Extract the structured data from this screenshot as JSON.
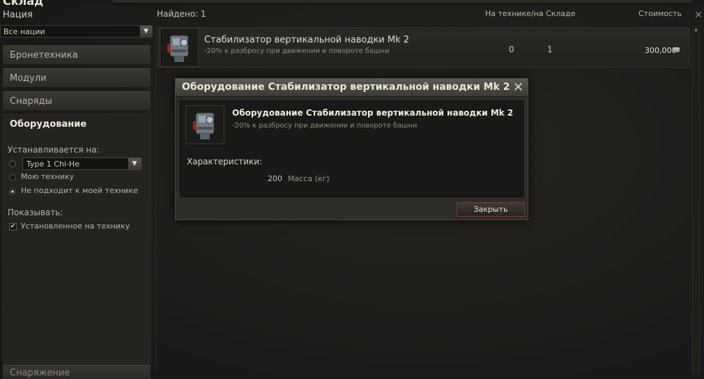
{
  "window": {
    "title": "Склад"
  },
  "sidebar": {
    "nation_label": "Нация",
    "nation_select": "Все нации",
    "categories": [
      {
        "label": "Бронетехника"
      },
      {
        "label": "Модули"
      },
      {
        "label": "Снаряды"
      },
      {
        "label": "Оборудование"
      }
    ],
    "installed_on_label": "Устанавливается на:",
    "vehicle_select": "Type 1 Chi-He",
    "radio_options": [
      {
        "label": "",
        "selected": false
      },
      {
        "label": "Мою технику",
        "selected": false
      },
      {
        "label": "Не подходит к моей технике",
        "selected": true
      }
    ],
    "show_label": "Показывать:",
    "checkbox_label": "Установленное на технику",
    "checkbox_checked": true,
    "bottom_category": "Снаряжение"
  },
  "header": {
    "found": "Найдено: 1",
    "col_vehicle_stock": "На технике/на Складе",
    "col_cost": "Стоимость"
  },
  "list": {
    "items": [
      {
        "title": "Стабилизатор вертикальной наводки Mk 2",
        "subtitle": "-20% к разбросу при движении и повороте башни",
        "on_vehicle": "0",
        "in_stock": "1",
        "price": "300,000"
      }
    ]
  },
  "modal": {
    "title": "Оборудование Стабилизатор вертикальной наводки Mk 2",
    "item_title": "Оборудование Стабилизатор вертикальной наводки Mk 2",
    "item_subtitle": "-20% к разбросу при движении и повороте башни",
    "characteristics_label": "Характеристики:",
    "stat_value": "200",
    "stat_unit": "Масса (кг)",
    "close_button": "Закрыть"
  },
  "icons": {
    "item": "stabilizer-icon",
    "close": "close-icon",
    "coin": "credits-icon"
  }
}
